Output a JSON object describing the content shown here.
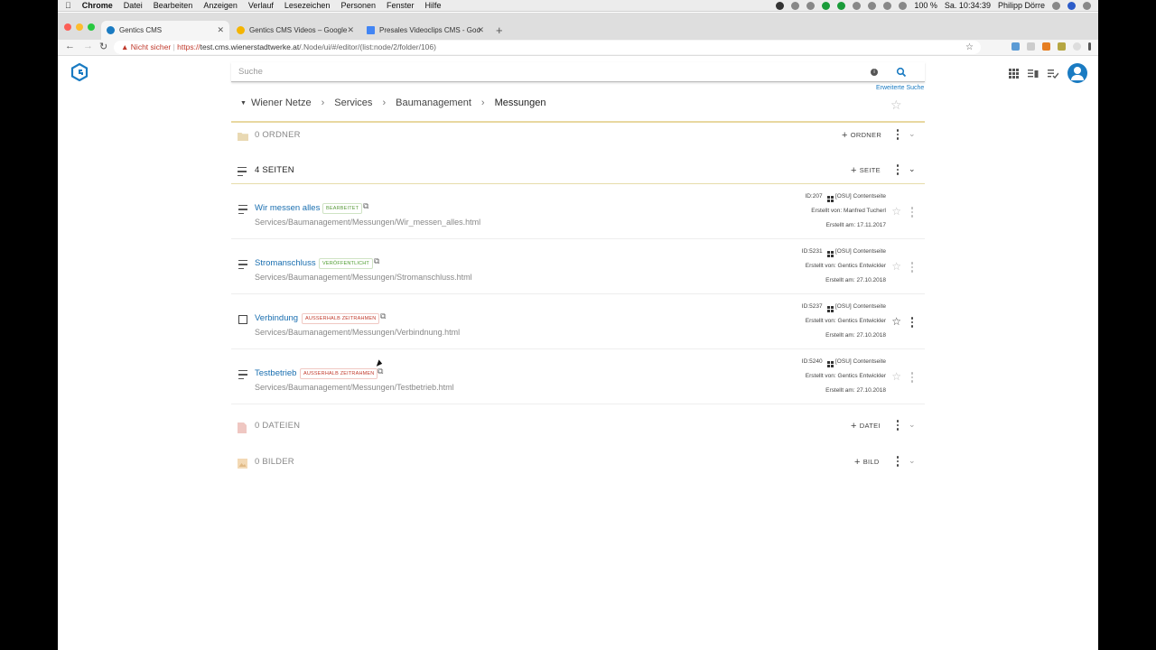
{
  "menubar": {
    "items": [
      "Chrome",
      "Datei",
      "Bearbeiten",
      "Anzeigen",
      "Verlauf",
      "Lesezeichen",
      "Personen",
      "Fenster",
      "Hilfe"
    ],
    "battery": "100 %",
    "clock": "Sa. 10:34:39",
    "user": "Philipp Dörre"
  },
  "tabs": [
    {
      "label": "Gentics CMS",
      "active": true
    },
    {
      "label": "Gentics CMS Videos – Google",
      "active": false
    },
    {
      "label": "Presales Videoclips CMS - Goo",
      "active": false
    }
  ],
  "address": {
    "warning": "Nicht sicher",
    "protocol": "https://",
    "host": "test.cms.wienerstadtwerke.at",
    "path": "/.Node/ui/#/editor/(list:node/2/folder/106)"
  },
  "search": {
    "placeholder": "Suche",
    "advanced_link": "Erweiterte Suche"
  },
  "breadcrumb": [
    "Wiener Netze",
    "Services",
    "Baumanagement",
    "Messungen"
  ],
  "sections": {
    "folders": {
      "title": "0 ORDNER",
      "add_label": "ORDNER"
    },
    "pages": {
      "title": "4 SEITEN",
      "add_label": "SEITE"
    },
    "files": {
      "title": "0 DATEIEN",
      "add_label": "DATEI"
    },
    "images": {
      "title": "0 BILDER",
      "add_label": "BILD"
    }
  },
  "pages": [
    {
      "title": "Wir messen alles",
      "status": "BEARBEITET",
      "path": "Services/Baumanagement/Messungen/Wir_messen_alles.html",
      "id": "ID:207",
      "template": "[OSU] Contentseite",
      "created_by": "Erstellt von: Manfred Tucherl",
      "created_at": "Erstellt am: 17.11.2017"
    },
    {
      "title": "Stromanschluss",
      "status": "VERÖFFENTLICHT",
      "path": "Services/Baumanagement/Messungen/Stromanschluss.html",
      "id": "ID:5231",
      "template": "[OSU] Contentseite",
      "created_by": "Erstellt von: Gentics Entwickler",
      "created_at": "Erstellt am: 27.10.2018"
    },
    {
      "title": "Verbindung",
      "status": "AUSSERHALB ZEITRAHMEN",
      "path": "Services/Baumanagement/Messungen/Verbindnung.html",
      "id": "ID:5237",
      "template": "[OSU] Contentseite",
      "created_by": "Erstellt von: Gentics Entwickler",
      "created_at": "Erstellt am: 27.10.2018"
    },
    {
      "title": "Testbetrieb",
      "status": "AUSSERHALB ZEITRAHMEN",
      "path": "Services/Baumanagement/Messungen/Testbetrieb.html",
      "id": "ID:5240",
      "template": "[OSU] Contentseite",
      "created_by": "Erstellt von: Gentics Entwickler",
      "created_at": "Erstellt am: 27.10.2018"
    }
  ],
  "colors": {
    "accent": "#1a7bc2",
    "link": "#1a6fb0",
    "published": "#4a9a2a",
    "outside": "#c0392b",
    "divider": "#e8d8a0"
  }
}
